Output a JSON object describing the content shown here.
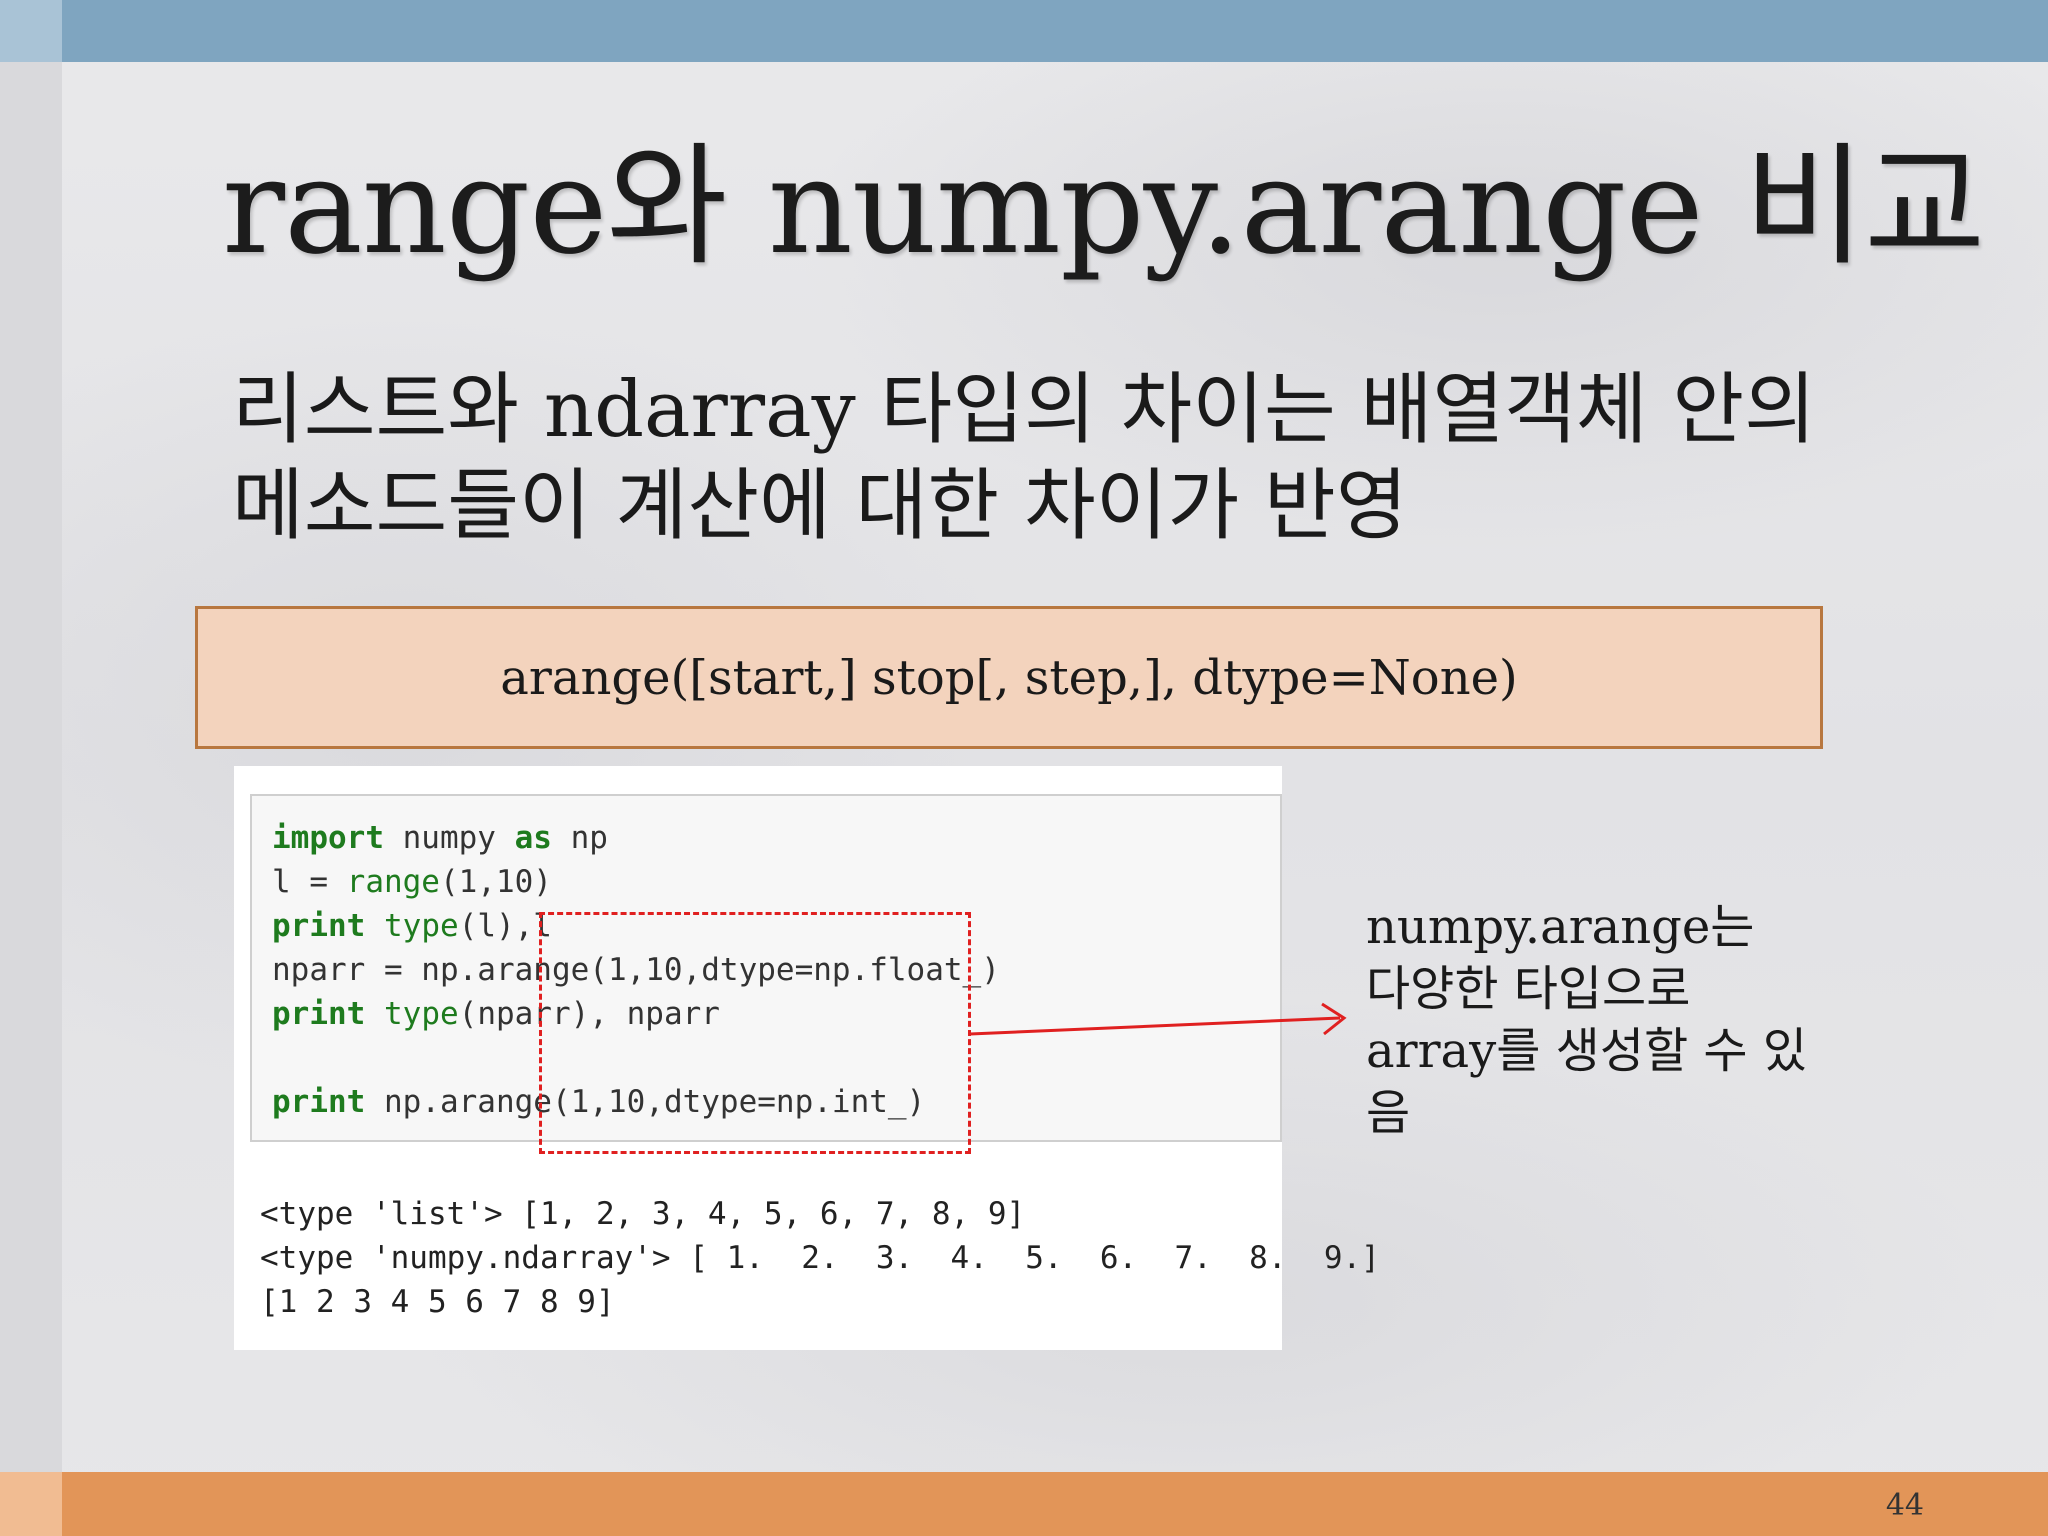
{
  "slide": {
    "title": "range와 numpy.arange 비교",
    "subtitle_lines": [
      "리스트와 ndarray  타입의 차이는 배열객체 안의",
      "메소드들이 계산에 대한 차이가 반영"
    ],
    "signature": "arange([start,] stop[, step,], dtype=None)",
    "code": {
      "line1": {
        "kw": "import",
        "rest1": " numpy ",
        "kw2": "as",
        "rest2": " np"
      },
      "line2": {
        "a": "l = ",
        "b": "range",
        "c": "(1,10)"
      },
      "line3": {
        "kw": "print",
        "sp": " ",
        "b": "type",
        "c": "(l),l"
      },
      "line4": {
        "a": "nparr = np.arange(1,10,dtype=np.float_)"
      },
      "line5": {
        "kw": "print",
        "sp": " ",
        "b": "type",
        "c": "(nparr), nparr"
      },
      "line6": {
        "kw": "print",
        "c": " np.arange(1,10,dtype=np.int_)"
      }
    },
    "output": [
      "<type 'list'> [1, 2, 3, 4, 5, 6, 7, 8, 9]",
      "<type 'numpy.ndarray'> [ 1.  2.  3.  4.  5.  6.  7.  8.  9.]",
      "[1 2 3 4 5 6 7 8 9]"
    ],
    "note_lines": [
      "numpy.arange는",
      "다양한 타입으로",
      "array를 생성할 수 있",
      "음"
    ],
    "page_number": "44"
  },
  "colors": {
    "top_bar": "#7fa5c0",
    "bottom_bar": "#e29558",
    "signature_fill": "#f3d3bd",
    "signature_border": "#b8773f",
    "highlight": "#e02020",
    "keyword": "#1e7b1e"
  }
}
